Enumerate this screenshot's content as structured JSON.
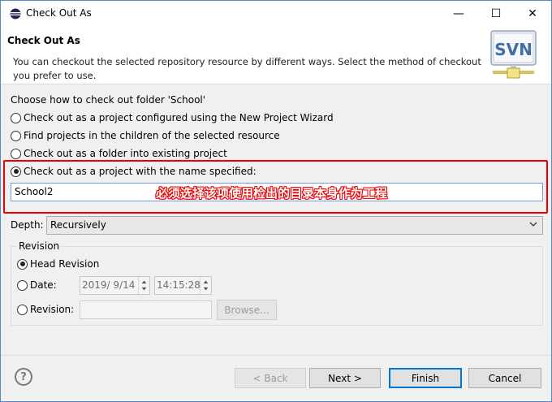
{
  "window": {
    "title": "Check Out As",
    "minimize": "—",
    "maximize": "☐",
    "close": "✕"
  },
  "header": {
    "title": "Check Out As",
    "description": "You can checkout the selected repository resource by different ways. Select the method of checkout you prefer to use.",
    "logo_text": "SVN"
  },
  "checkout": {
    "prompt": "Choose how to check out folder 'School'",
    "options": [
      {
        "label": "Check out as a project configured using the New Project Wizard",
        "checked": false
      },
      {
        "label": "Find projects in the children of the selected resource",
        "checked": false
      },
      {
        "label": "Check out as a folder into existing project",
        "checked": false
      },
      {
        "label": "Check out as a project with the name specified:",
        "checked": true
      }
    ],
    "project_name": "School2",
    "annotation": "必须选择该项使用检出的目录本身作为工程"
  },
  "depth": {
    "label": "Depth:",
    "value": "Recursively"
  },
  "revision": {
    "legend": "Revision",
    "head_label": "Head Revision",
    "head_checked": true,
    "date_label": "Date:",
    "date_value": "2019/  9/14",
    "time_value": "14:15:28",
    "revision_label": "Revision:",
    "browse_label": "Browse..."
  },
  "footer": {
    "help": "?",
    "back": "< Back",
    "next": "Next >",
    "finish": "Finish",
    "cancel": "Cancel"
  },
  "colors": {
    "annotation": "#e00000",
    "focus_border": "#0078d7"
  }
}
